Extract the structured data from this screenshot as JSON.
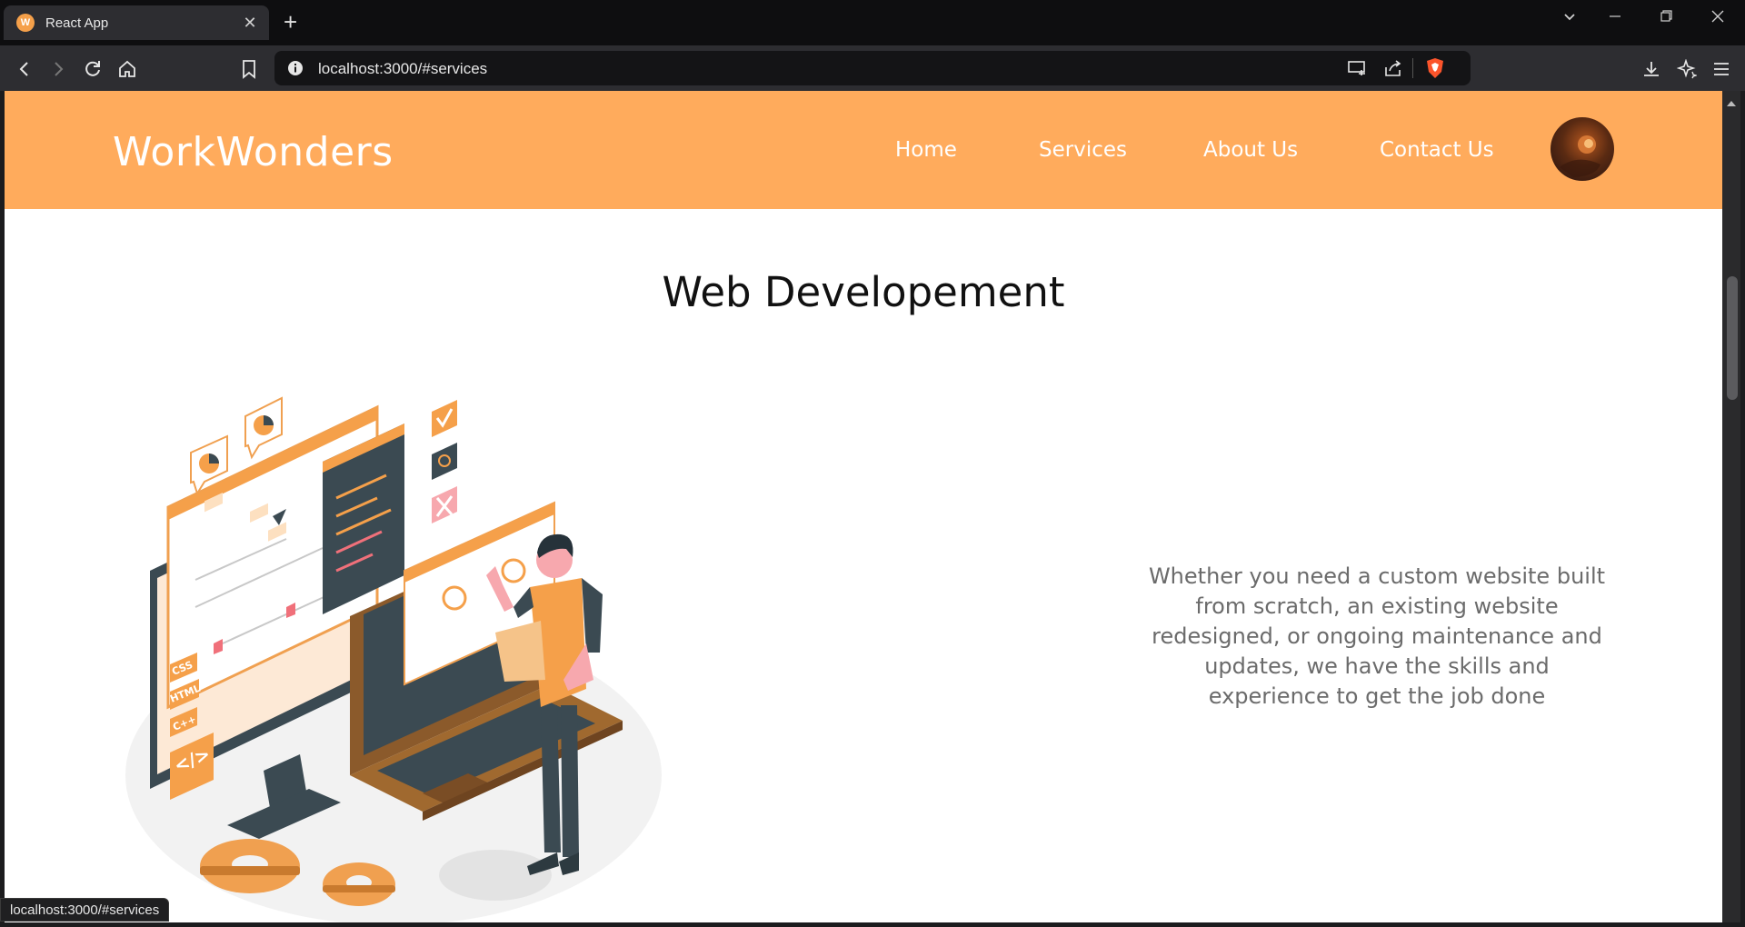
{
  "browser": {
    "tab_title": "React App",
    "tab_favicon_letter": "W",
    "url": "localhost:3000/#services",
    "status_url": "localhost:3000/#services"
  },
  "nav": {
    "brand": "WorkWonders",
    "links": [
      "Home",
      "Services",
      "About Us",
      "Contact Us"
    ]
  },
  "section": {
    "title": "Web Developement",
    "description": "Whether you need a custom website built from scratch, an existing website redesigned, or ongoing maintenance and updates, we have the skills and experience to get the job done",
    "illustration_labels": [
      "CSS",
      "HTML",
      "C++",
      "</>"
    ]
  },
  "colors": {
    "brand_orange": "#ffab5c",
    "text_gray": "#6b6b6b"
  },
  "icons": [
    "back-icon",
    "forward-icon",
    "reload-icon",
    "home-icon",
    "bookmark-icon",
    "info-icon",
    "cast-icon",
    "share-icon",
    "brave-shield-icon",
    "download-icon",
    "leo-ai-icon",
    "menu-icon"
  ]
}
